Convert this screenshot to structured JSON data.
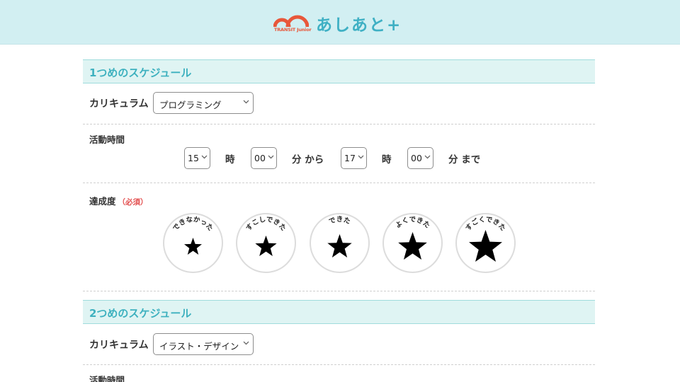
{
  "header": {
    "logo_sub": "TRANSIT Junior",
    "logo_text": "あしあと+",
    "brand_color": "#e8573a",
    "accent_color": "#3fb0c4"
  },
  "schedules": [
    {
      "title": "1つめのスケジュール",
      "curriculum_label": "カリキュラム",
      "curriculum_value": "プログラミング",
      "time_label": "活動時間",
      "start_hour": "15",
      "hour_word": "時",
      "start_min": "00",
      "from_word": "分 から",
      "end_hour": "17",
      "end_min": "00",
      "until_word": "分 まで",
      "achievement_label": "達成度",
      "required_label": "（必須）",
      "levels": [
        {
          "label": "できなかった",
          "icon": "star-icon"
        },
        {
          "label": "すこしできた",
          "icon": "star-icon"
        },
        {
          "label": "できた",
          "icon": "star-icon"
        },
        {
          "label": "よくできた",
          "icon": "star-icon"
        },
        {
          "label": "すごくできた",
          "icon": "star-icon"
        }
      ]
    },
    {
      "title": "2つめのスケジュール",
      "curriculum_label": "カリキュラム",
      "curriculum_value": "イラスト・デザイン",
      "time_label": "活動時間"
    }
  ]
}
